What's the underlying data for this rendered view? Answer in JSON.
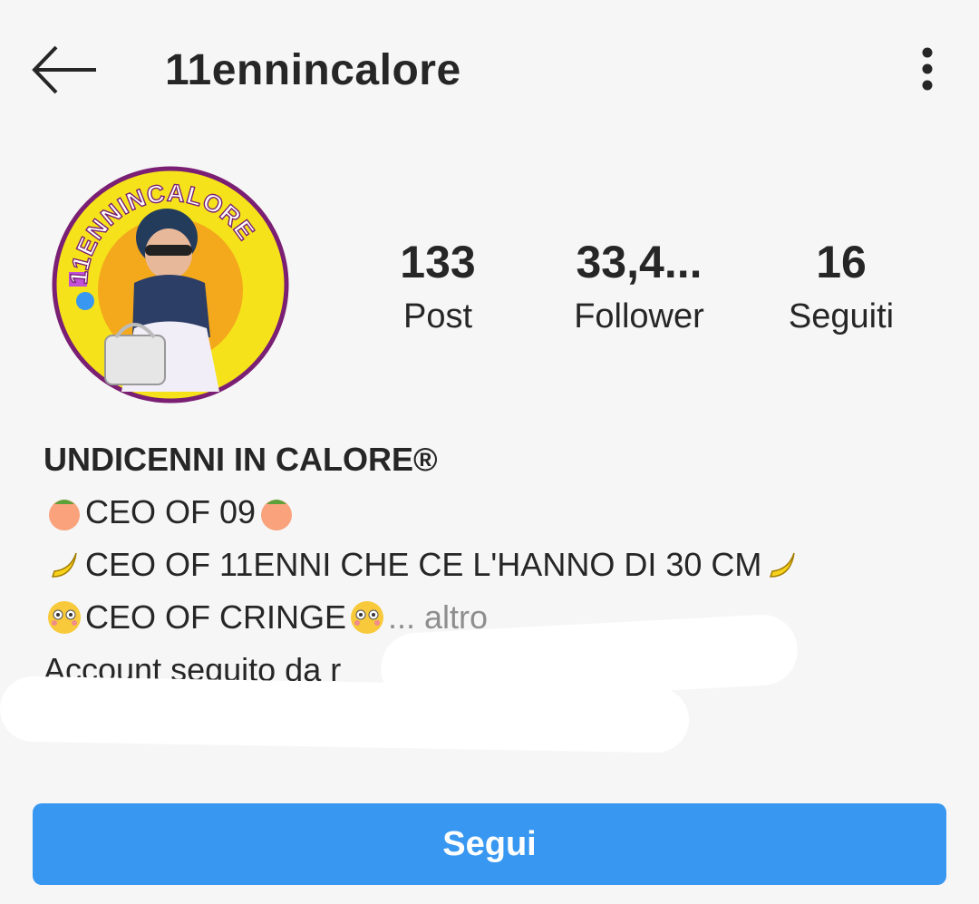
{
  "header": {
    "username": "11ennincalore",
    "back_icon": "arrow-left-icon",
    "menu_icon": "more-vertical-icon"
  },
  "profile": {
    "avatar_text": "11ENNINCALORE",
    "stats": [
      {
        "value": "133",
        "label": "Post"
      },
      {
        "value": "33,4...",
        "label": "Follower"
      },
      {
        "value": "16",
        "label": "Seguiti"
      }
    ]
  },
  "bio": {
    "name": "UNDICENNI IN CALORE®",
    "line1": "CEO OF 09",
    "line2": " CEO OF 11ENNI CHE CE L'HANNO DI 30 CM",
    "line3": "CEO OF CRINGE",
    "more": "... altro",
    "followed_by": "Account seguito da r"
  },
  "actions": {
    "follow_label": "Segui"
  },
  "colors": {
    "background": "#f6f6f6",
    "text": "#262626",
    "secondary": "#8e8e8e",
    "follow_button": "#3897f0",
    "avatar_ring": "#7a1f73",
    "avatar_bg": "#f5e21a"
  }
}
